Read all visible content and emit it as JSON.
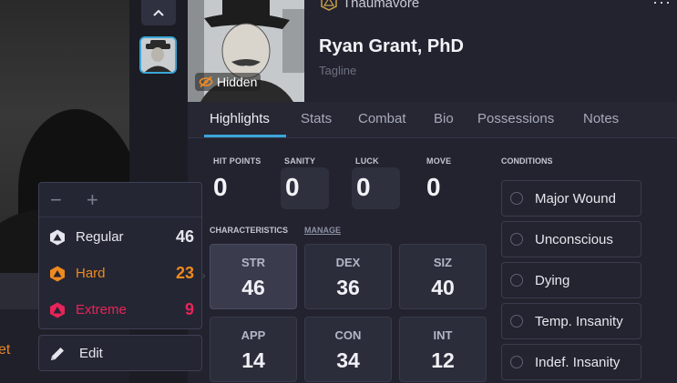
{
  "header": {
    "app_name": "Thaumavore",
    "character_name": "Ryan Grant, PhD",
    "tagline_placeholder": "Tagline",
    "portrait_badge": "Hidden"
  },
  "tabs": [
    {
      "label": "Highlights",
      "active": true
    },
    {
      "label": "Stats"
    },
    {
      "label": "Combat"
    },
    {
      "label": "Bio"
    },
    {
      "label": "Possessions"
    },
    {
      "label": "Notes"
    }
  ],
  "highlights": {
    "hit_points": {
      "label": "HIT POINTS",
      "value": "0"
    },
    "sanity": {
      "label": "SANITY",
      "value": "0"
    },
    "luck": {
      "label": "LUCK",
      "value": "0"
    },
    "move": {
      "label": "MOVE",
      "value": "0"
    }
  },
  "characteristics": {
    "heading": "CHARACTERISTICS",
    "manage_label": "MANAGE",
    "items": [
      {
        "label": "STR",
        "value": "46"
      },
      {
        "label": "DEX",
        "value": "36"
      },
      {
        "label": "SIZ",
        "value": "40"
      },
      {
        "label": "APP",
        "value": "14"
      },
      {
        "label": "CON",
        "value": "34"
      },
      {
        "label": "INT",
        "value": "12"
      }
    ]
  },
  "conditions": {
    "heading": "CONDITIONS",
    "items": [
      "Major Wound",
      "Unconscious",
      "Dying",
      "Temp. Insanity",
      "Indef. Insanity"
    ]
  },
  "difficulty_popover": {
    "rows": [
      {
        "name": "Regular",
        "value": "46",
        "color": "#e6e7ee"
      },
      {
        "name": "Hard",
        "value": "23",
        "color": "#ef8a1f"
      },
      {
        "name": "Extreme",
        "value": "9",
        "color": "#e8245a"
      }
    ],
    "edit_label": "Edit"
  },
  "backdrop_text": "et",
  "colors": {
    "accent": "#3aa6d8",
    "hard": "#ef8a1f",
    "extreme": "#e8245a"
  }
}
